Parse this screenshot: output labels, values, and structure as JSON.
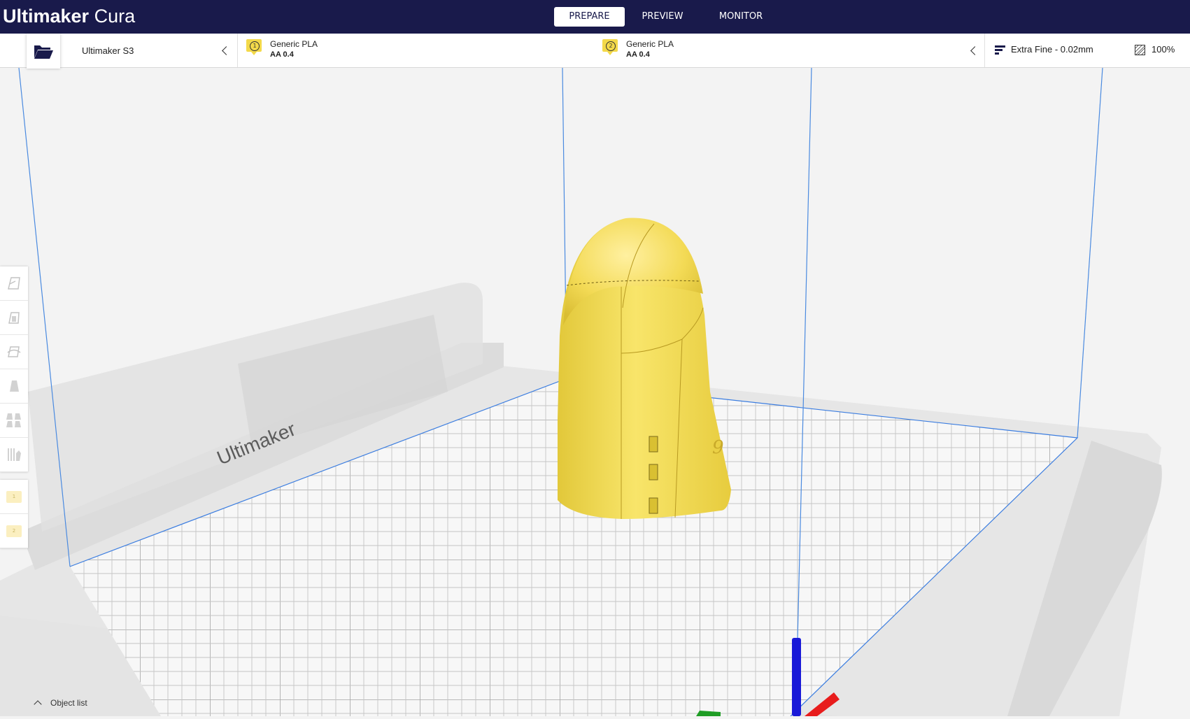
{
  "app": {
    "logo_bold": "Ultimaker",
    "logo_light": "Cura"
  },
  "stages": [
    {
      "label": "PREPARE",
      "active": true
    },
    {
      "label": "PREVIEW",
      "active": false
    },
    {
      "label": "MONITOR",
      "active": false
    }
  ],
  "printer": {
    "name": "Ultimaker S3"
  },
  "extruders": [
    {
      "index": "1",
      "material": "Generic PLA",
      "core": "AA 0.4",
      "color": "#f3d94a"
    },
    {
      "index": "2",
      "material": "Generic PLA",
      "core": "AA 0.4",
      "color": "#f3d94a"
    }
  ],
  "print_setup": {
    "profile": "Extra Fine - 0.02mm",
    "infill": "100%"
  },
  "viewport": {
    "plate_brand": "Ultimaker",
    "model_color": "#f5e05a",
    "axes": {
      "x": "#e81c1c",
      "y": "#1f9d25",
      "z": "#1a1ad8"
    }
  },
  "tools": [
    {
      "name": "move-tool"
    },
    {
      "name": "scale-tool"
    },
    {
      "name": "rotate-tool"
    },
    {
      "name": "mirror-tool"
    },
    {
      "name": "per-model-settings-tool"
    },
    {
      "name": "support-blocker-tool"
    }
  ],
  "extruder_buttons": [
    {
      "label": "1"
    },
    {
      "label": "2"
    }
  ],
  "object_list": {
    "label": "Object list"
  }
}
